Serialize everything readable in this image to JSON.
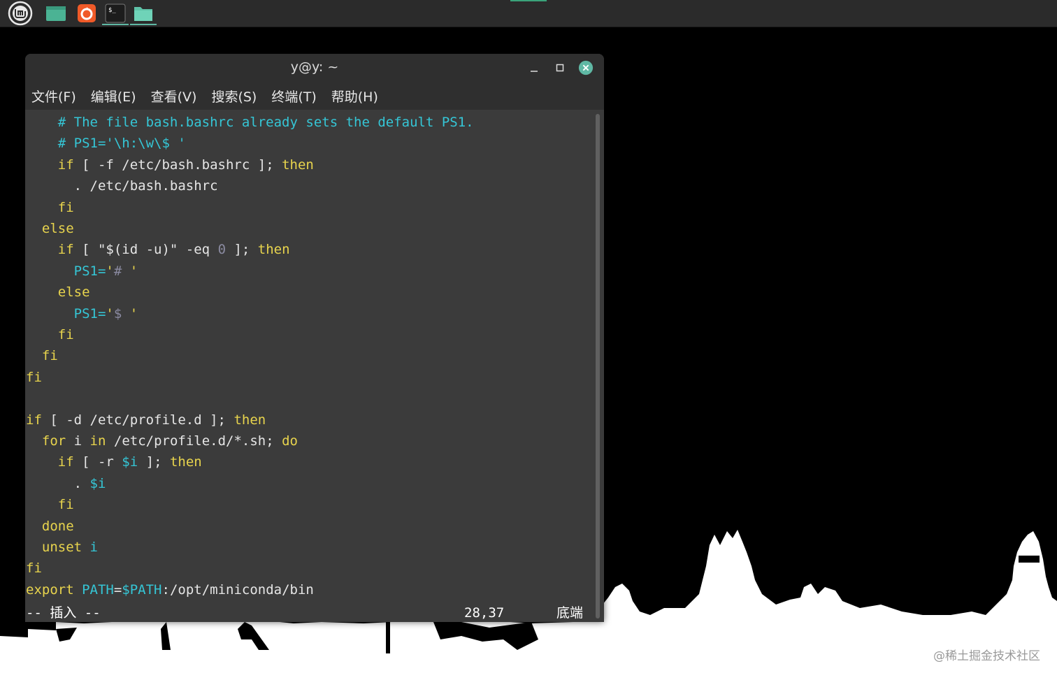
{
  "window": {
    "title": "y@y: ~"
  },
  "menu": [
    "文件(F)",
    "编辑(E)",
    "查看(V)",
    "搜索(S)",
    "终端(T)",
    "帮助(H)"
  ],
  "editor_lines": [
    [
      {
        "t": "    ",
        "c": "pl"
      },
      {
        "t": "# The file bash.bashrc already sets the default PS1.",
        "c": "cm"
      }
    ],
    [
      {
        "t": "    ",
        "c": "pl"
      },
      {
        "t": "# PS1='\\h:\\w\\$ '",
        "c": "cm"
      }
    ],
    [
      {
        "t": "    ",
        "c": "pl"
      },
      {
        "t": "if",
        "c": "kw"
      },
      {
        "t": " [ -f /etc/bash.bashrc ]; ",
        "c": "pl"
      },
      {
        "t": "then",
        "c": "kw"
      }
    ],
    [
      {
        "t": "      . /etc/bash.bashrc",
        "c": "pl"
      }
    ],
    [
      {
        "t": "    ",
        "c": "pl"
      },
      {
        "t": "fi",
        "c": "kw"
      }
    ],
    [
      {
        "t": "  ",
        "c": "pl"
      },
      {
        "t": "else",
        "c": "kw"
      }
    ],
    [
      {
        "t": "    ",
        "c": "pl"
      },
      {
        "t": "if",
        "c": "kw"
      },
      {
        "t": " [ \"$(id -u)\" -eq ",
        "c": "pl"
      },
      {
        "t": "0",
        "c": "num"
      },
      {
        "t": " ]; ",
        "c": "pl"
      },
      {
        "t": "then",
        "c": "kw"
      }
    ],
    [
      {
        "t": "      ",
        "c": "pl"
      },
      {
        "t": "PS1=",
        "c": "vr"
      },
      {
        "t": "'",
        "c": "kw"
      },
      {
        "t": "# ",
        "c": "num"
      },
      {
        "t": "'",
        "c": "kw"
      }
    ],
    [
      {
        "t": "    ",
        "c": "pl"
      },
      {
        "t": "else",
        "c": "kw"
      }
    ],
    [
      {
        "t": "      ",
        "c": "pl"
      },
      {
        "t": "PS1=",
        "c": "vr"
      },
      {
        "t": "'",
        "c": "kw"
      },
      {
        "t": "$ ",
        "c": "num"
      },
      {
        "t": "'",
        "c": "kw"
      }
    ],
    [
      {
        "t": "    ",
        "c": "pl"
      },
      {
        "t": "fi",
        "c": "kw"
      }
    ],
    [
      {
        "t": "  ",
        "c": "pl"
      },
      {
        "t": "fi",
        "c": "kw"
      }
    ],
    [
      {
        "t": "fi",
        "c": "kw"
      }
    ],
    [],
    [
      {
        "t": "if",
        "c": "kw"
      },
      {
        "t": " [ -d /etc/profile.d ]; ",
        "c": "pl"
      },
      {
        "t": "then",
        "c": "kw"
      }
    ],
    [
      {
        "t": "  ",
        "c": "pl"
      },
      {
        "t": "for",
        "c": "kw"
      },
      {
        "t": " i ",
        "c": "pl"
      },
      {
        "t": "in",
        "c": "kw"
      },
      {
        "t": " /etc/profile.d/*.sh; ",
        "c": "pl"
      },
      {
        "t": "do",
        "c": "kw"
      }
    ],
    [
      {
        "t": "    ",
        "c": "pl"
      },
      {
        "t": "if",
        "c": "kw"
      },
      {
        "t": " [ -r ",
        "c": "pl"
      },
      {
        "t": "$i",
        "c": "vr"
      },
      {
        "t": " ]; ",
        "c": "pl"
      },
      {
        "t": "then",
        "c": "kw"
      }
    ],
    [
      {
        "t": "      . ",
        "c": "pl"
      },
      {
        "t": "$i",
        "c": "vr"
      }
    ],
    [
      {
        "t": "    ",
        "c": "pl"
      },
      {
        "t": "fi",
        "c": "kw"
      }
    ],
    [
      {
        "t": "  ",
        "c": "pl"
      },
      {
        "t": "done",
        "c": "kw"
      }
    ],
    [
      {
        "t": "  ",
        "c": "pl"
      },
      {
        "t": "unset",
        "c": "kw"
      },
      {
        "t": " i",
        "c": "vr"
      }
    ],
    [
      {
        "t": "fi",
        "c": "kw"
      }
    ],
    [
      {
        "t": "export",
        "c": "kw"
      },
      {
        "t": " PATH",
        "c": "vr"
      },
      {
        "t": "=",
        "c": "pl"
      },
      {
        "t": "$PATH",
        "c": "vr"
      },
      {
        "t": ":/opt/miniconda/bin",
        "c": "pl"
      }
    ]
  ],
  "status": {
    "mode": "-- 插入 --",
    "position": "28,37",
    "scroll": "底端"
  },
  "watermark": "@稀土掘金技术社区",
  "taskbar_icons": [
    "mint-menu-icon",
    "show-desktop-icon",
    "firefox-icon",
    "terminal-icon",
    "files-icon"
  ],
  "colors": {
    "keyword": "#e8d44d",
    "comment": "#35c6d6",
    "terminal_bg": "#3b3b3b",
    "taskbar_bg": "#2b2b2b"
  }
}
